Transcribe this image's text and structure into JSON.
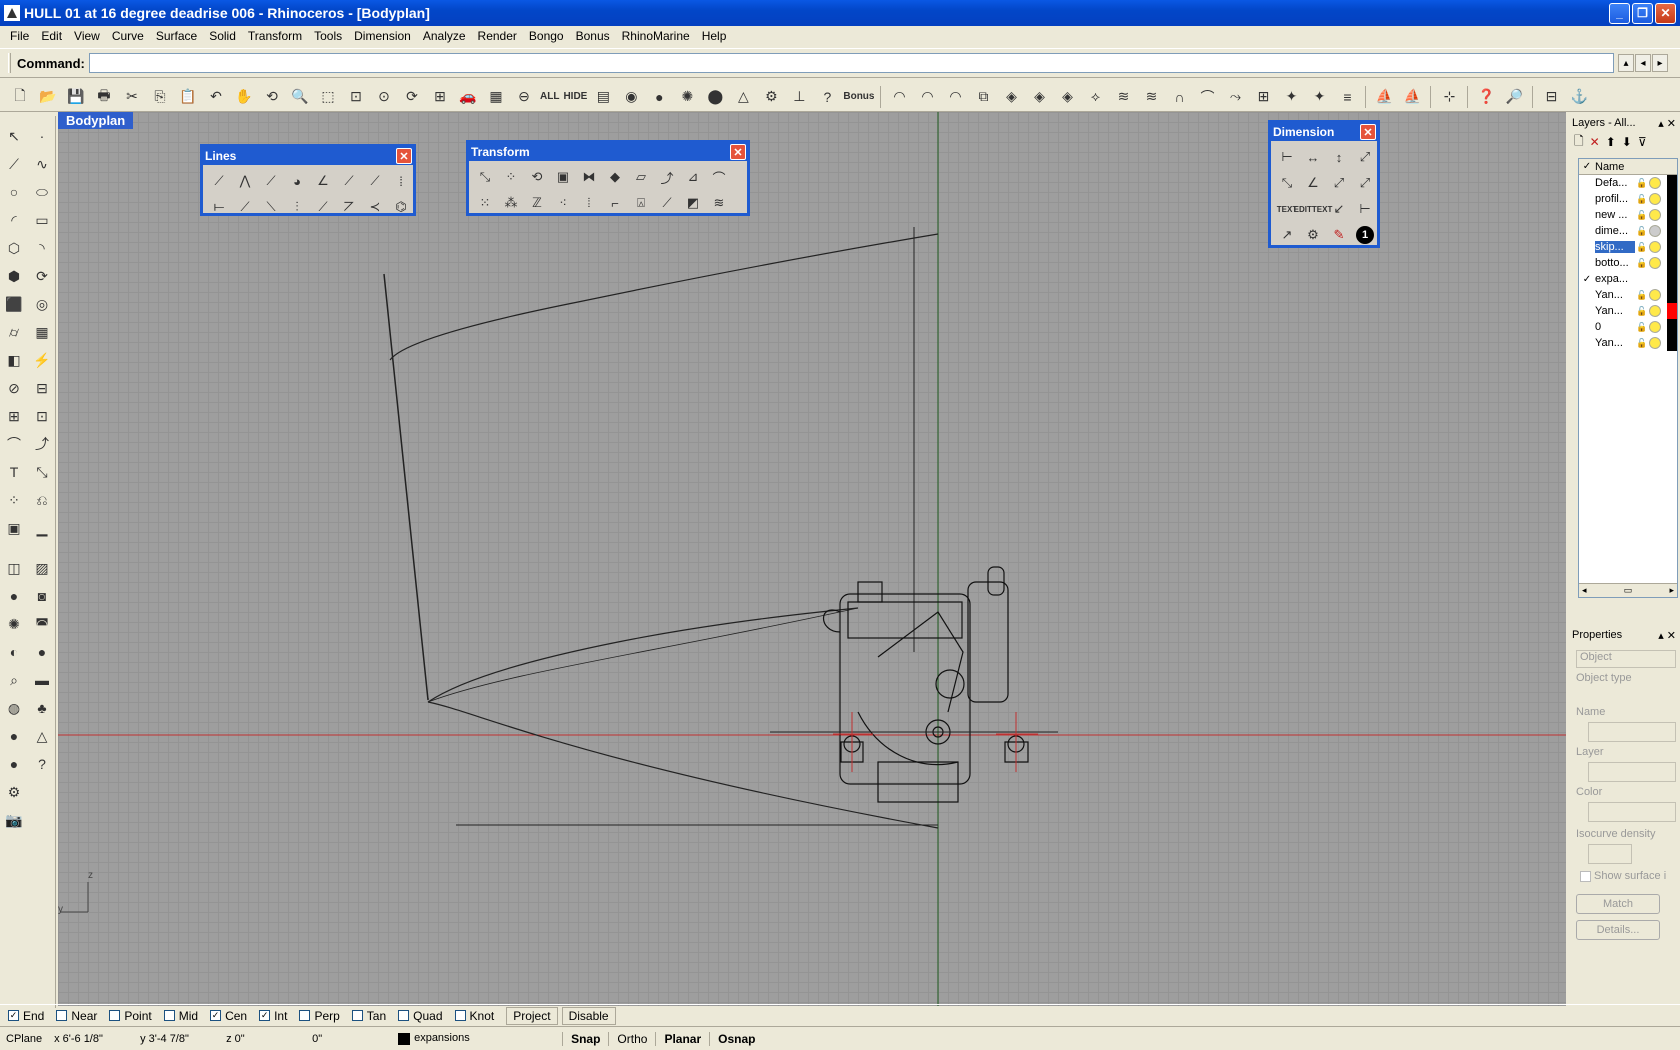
{
  "window": {
    "title": "HULL 01 at 16 degree deadrise 006 - Rhinoceros - [Bodyplan]",
    "min_glyph": "_",
    "max_glyph": "❐",
    "close_glyph": "✕"
  },
  "menu": [
    "File",
    "Edit",
    "View",
    "Curve",
    "Surface",
    "Solid",
    "Transform",
    "Tools",
    "Dimension",
    "Analyze",
    "Render",
    "Bongo",
    "Bonus",
    "RhinoMarine",
    "Help"
  ],
  "command": {
    "label": "Command:",
    "value": ""
  },
  "toolbar": {
    "all_label": "ALL",
    "hide_label": "HIDE",
    "bonus_label": "Bonus"
  },
  "viewport": {
    "title": "Bodyplan",
    "axis_z": "z",
    "axis_y": "y"
  },
  "floating": {
    "lines_title": "Lines",
    "transform_title": "Transform",
    "dimension_title": "Dimension",
    "dim_text": "TEXT",
    "dim_edit": "EDIT",
    "dim_edit2": "TEXT",
    "dim_number": "1"
  },
  "layers": {
    "title": "Layers - All...",
    "name_header": "Name",
    "rows": [
      {
        "name": "Defa...",
        "check": "",
        "color": "#000000"
      },
      {
        "name": "profil...",
        "check": "",
        "color": "#000000"
      },
      {
        "name": "new ...",
        "check": "",
        "color": "#000000"
      },
      {
        "name": "dime...",
        "check": "",
        "color": "#000000"
      },
      {
        "name": "skip...",
        "check": "",
        "color": "#000000"
      },
      {
        "name": "botto...",
        "check": "",
        "color": "#000000"
      },
      {
        "name": "expa...",
        "check": "✓",
        "color": "#000000"
      },
      {
        "name": "Yan...",
        "check": "",
        "color": "#000000"
      },
      {
        "name": "Yan...",
        "check": "",
        "color": "#ff0000"
      },
      {
        "name": "0",
        "check": "",
        "color": "#000000"
      },
      {
        "name": "Yan...",
        "check": "",
        "color": "#000000"
      }
    ]
  },
  "properties": {
    "title": "Properties",
    "object_select": "Object",
    "object_type": "Object type",
    "name_label": "Name",
    "layer_label": "Layer",
    "color_label": "Color",
    "isocurve_label": "Isocurve density",
    "show_surface": "Show surface i",
    "match_btn": "Match",
    "details_btn": "Details..."
  },
  "osnap": {
    "items": [
      {
        "label": "End",
        "checked": "✓"
      },
      {
        "label": "Near",
        "checked": ""
      },
      {
        "label": "Point",
        "checked": ""
      },
      {
        "label": "Mid",
        "checked": ""
      },
      {
        "label": "Cen",
        "checked": "✓"
      },
      {
        "label": "Int",
        "checked": "✓"
      },
      {
        "label": "Perp",
        "checked": ""
      },
      {
        "label": "Tan",
        "checked": ""
      },
      {
        "label": "Quad",
        "checked": ""
      },
      {
        "label": "Knot",
        "checked": ""
      }
    ],
    "project": "Project",
    "disable": "Disable"
  },
  "status": {
    "cplane": "CPlane",
    "x": "x 6'-6 1/8\"",
    "y": "y 3'-4 7/8\"",
    "z": "z 0\"",
    "d": "0\"",
    "layer": "expansions",
    "snap": "Snap",
    "ortho": "Ortho",
    "planar": "Planar",
    "osnap": "Osnap"
  },
  "colors": {
    "xaxis": "#c03030",
    "zaxis": "#206020",
    "titlebar": "#0a58e4"
  }
}
